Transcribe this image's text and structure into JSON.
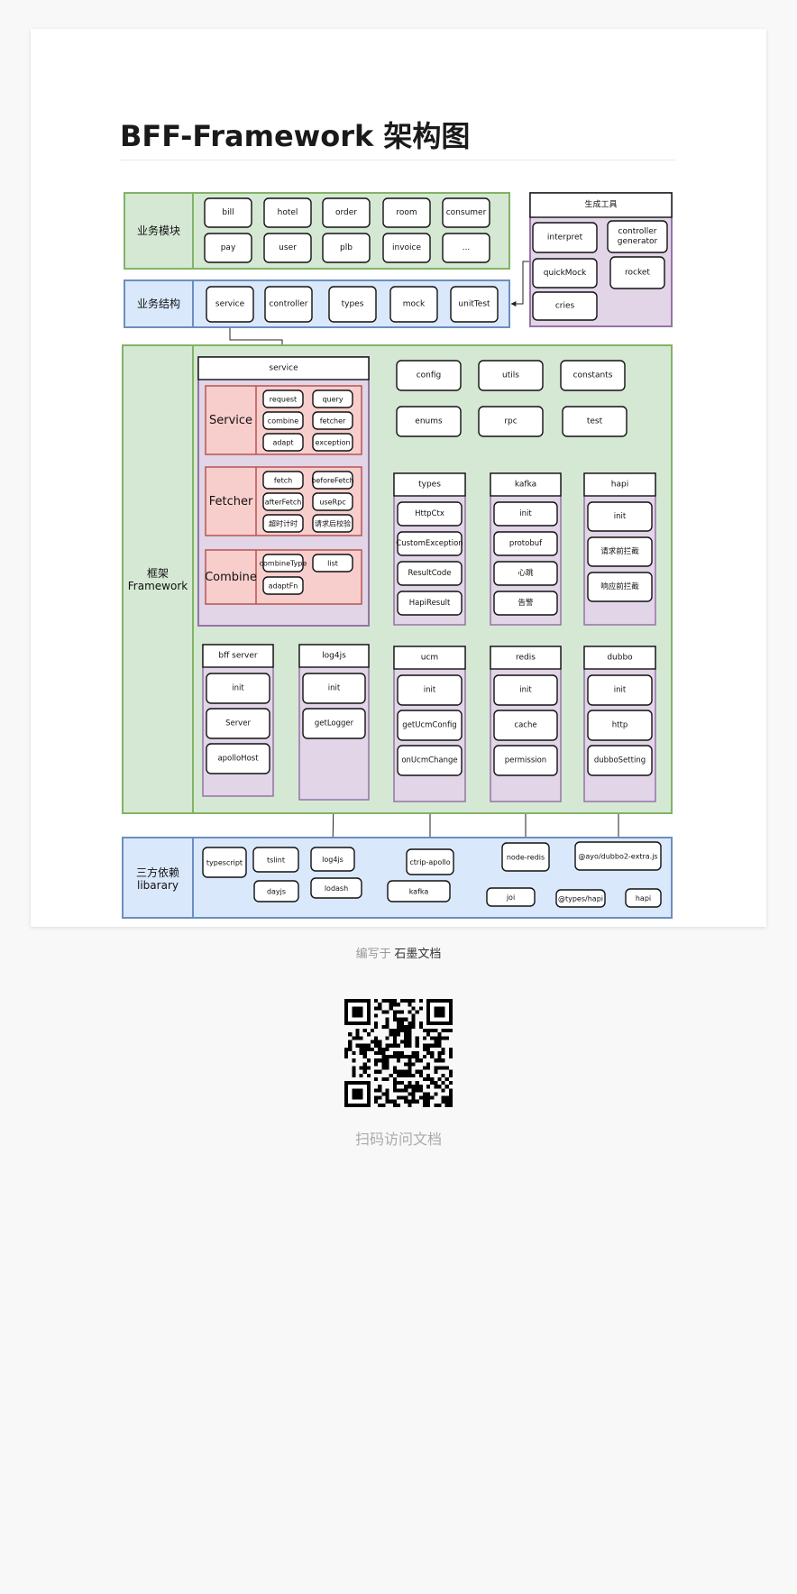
{
  "doc": {
    "title": "BFF-Framework 架构图",
    "written_prefix": "编写于",
    "written_brand": "石墨文档",
    "scan_label": "扫码访问文档"
  },
  "diagram": {
    "business_modules": {
      "label": "业务模块",
      "items": [
        "bill",
        "hotel",
        "order",
        "room",
        "consumer",
        "pay",
        "user",
        "plb",
        "invoice",
        "..."
      ]
    },
    "tools": {
      "title": "生成工具",
      "items": [
        "interpret",
        "controller generator",
        "quickMock",
        "rocket",
        "cries"
      ]
    },
    "business_structure": {
      "label": "业务结构",
      "items": [
        "service",
        "controller",
        "types",
        "mock",
        "unitTest"
      ]
    },
    "framework": {
      "label": "框架\nFramework",
      "service_pkg": {
        "title": "service",
        "groups": [
          {
            "name": "Service",
            "items": [
              "request",
              "query",
              "combine",
              "fetcher",
              "adapt",
              "exception"
            ]
          },
          {
            "name": "Fetcher",
            "items": [
              "fetch",
              "beforeFetch",
              "afterFetch",
              "useRpc",
              "超时计时",
              "请求后校验"
            ]
          },
          {
            "name": "Combine",
            "items": [
              "combineType",
              "list",
              "adaptFn"
            ]
          }
        ]
      },
      "top_items": [
        "config",
        "utils",
        "constants",
        "enums",
        "rpc",
        "test"
      ],
      "modules_mid": [
        {
          "title": "types",
          "items": [
            "HttpCtx",
            "CustomException",
            "ResultCode",
            "HapiResult"
          ]
        },
        {
          "title": "kafka",
          "items": [
            "init",
            "protobuf",
            "心跳",
            "告警"
          ]
        },
        {
          "title": "hapi",
          "items": [
            "init",
            "请求前拦截",
            "响应前拦截"
          ]
        }
      ],
      "modules_bottom": [
        {
          "title": "bff server",
          "items": [
            "init",
            "Server",
            "apolloHost"
          ]
        },
        {
          "title": "log4js",
          "items": [
            "init",
            "getLogger"
          ]
        },
        {
          "title": "ucm",
          "items": [
            "init",
            "getUcmConfig",
            "onUcmChange"
          ]
        },
        {
          "title": "redis",
          "items": [
            "init",
            "cache",
            "permission"
          ]
        },
        {
          "title": "dubbo",
          "items": [
            "init",
            "http",
            "dubboSetting"
          ]
        }
      ]
    },
    "third_party": {
      "label": "三方依赖\nlibarary",
      "items": [
        "typescript",
        "tslint",
        "log4js",
        "ctrip-apollo",
        "node-redis",
        "@ayo/dubbo2-extra.js",
        "dayjs",
        "lodash",
        "kafka",
        "joi",
        "@types/hapi",
        "hapi"
      ]
    },
    "colors": {
      "green_fill": "#d5e8d4",
      "green_stroke": "#82b366",
      "blue_fill": "#dae8fc",
      "blue_stroke": "#6c8ebf",
      "purple_fill": "#e1d5e7",
      "purple_stroke": "#9673a6",
      "red_fill": "#f8cecc",
      "red_stroke": "#b85450"
    }
  }
}
